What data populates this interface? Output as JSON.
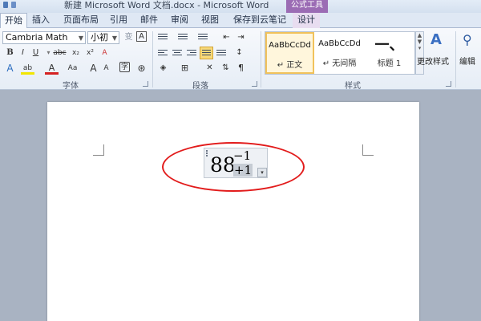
{
  "window": {
    "title": "新建 Microsoft Word 文档.docx - Microsoft Word",
    "context_title": "公式工具"
  },
  "tabs": [
    {
      "label": "开始",
      "active": true
    },
    {
      "label": "插入"
    },
    {
      "label": "页面布局"
    },
    {
      "label": "引用"
    },
    {
      "label": "邮件"
    },
    {
      "label": "审阅"
    },
    {
      "label": "视图"
    },
    {
      "label": "保存到云笔记"
    },
    {
      "label": "设计",
      "contextual": true
    }
  ],
  "font_group": {
    "label": "字体",
    "font_name": "Cambria Math",
    "font_size": "小初",
    "bold": "B",
    "italic": "I",
    "underline": "U",
    "strike": "abc",
    "subscript": "x₂",
    "superscript": "x²",
    "font_color_letter": "A",
    "change_case": "Aa",
    "grow_font": "A",
    "shrink_font": "A",
    "clear_format": "A",
    "phonetic": "变",
    "border_char": "A",
    "enclose": "字"
  },
  "paragraph_group": {
    "label": "段落"
  },
  "styles_group": {
    "label": "样式",
    "styles": [
      {
        "sample": "AaBbCcDd",
        "name": "↵ 正文",
        "selected": true
      },
      {
        "sample": "AaBbCcDd",
        "name": "↵ 无间隔"
      },
      {
        "sample": "一、",
        "name": "标题 1"
      }
    ],
    "change_styles": "更改样式"
  },
  "editing_group": {
    "label": "编辑"
  },
  "equation": {
    "base": "88",
    "superscript": "−1",
    "subscript": "+1",
    "arrow": "▾"
  },
  "colors": {
    "highlight": "#f8d979",
    "annotation": "#e21b1b",
    "context_tab": "#9b6cb4"
  }
}
